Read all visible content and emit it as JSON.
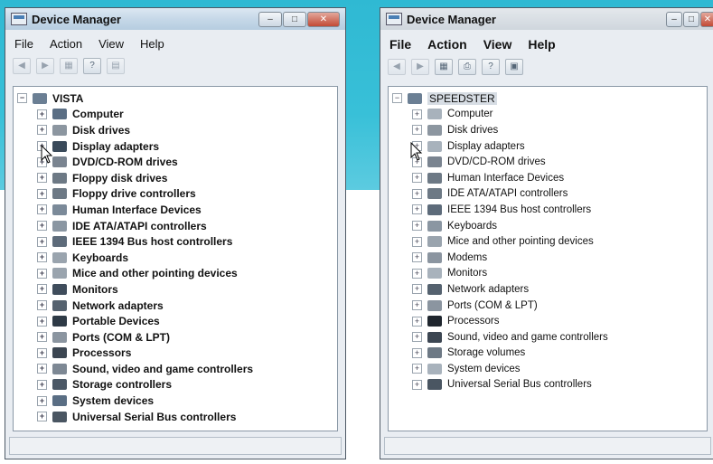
{
  "background_banner_color": "#38c0d8",
  "window_left": {
    "title": "Device Manager",
    "menu": [
      "File",
      "Action",
      "View",
      "Help"
    ],
    "root": "VISTA",
    "items": [
      {
        "label": "Computer",
        "icon": "computer-icon",
        "color": "#5a6e84"
      },
      {
        "label": "Disk drives",
        "icon": "disk-drive-icon",
        "color": "#8c96a0"
      },
      {
        "label": "Display adapters",
        "icon": "display-adapter-icon",
        "color": "#3a4a5a"
      },
      {
        "label": "DVD/CD-ROM drives",
        "icon": "dvd-drive-icon",
        "color": "#7a8490"
      },
      {
        "label": "Floppy disk drives",
        "icon": "floppy-drive-icon",
        "color": "#6d7985"
      },
      {
        "label": "Floppy drive controllers",
        "icon": "floppy-controller-icon",
        "color": "#6d7985"
      },
      {
        "label": "Human Interface Devices",
        "icon": "hid-icon",
        "color": "#7b8a99"
      },
      {
        "label": "IDE ATA/ATAPI controllers",
        "icon": "ide-controller-icon",
        "color": "#8a96a2"
      },
      {
        "label": "IEEE 1394 Bus host controllers",
        "icon": "ieee1394-icon",
        "color": "#5d6b7a"
      },
      {
        "label": "Keyboards",
        "icon": "keyboard-icon",
        "color": "#9aa4ae"
      },
      {
        "label": "Mice and other pointing devices",
        "icon": "mouse-icon",
        "color": "#9aa4ae"
      },
      {
        "label": "Monitors",
        "icon": "monitor-icon",
        "color": "#3f4d5c"
      },
      {
        "label": "Network adapters",
        "icon": "network-adapter-icon",
        "color": "#55626f"
      },
      {
        "label": "Portable Devices",
        "icon": "portable-device-icon",
        "color": "#2e3a46"
      },
      {
        "label": "Ports (COM & LPT)",
        "icon": "port-icon",
        "color": "#8b95a0"
      },
      {
        "label": "Processors",
        "icon": "processor-icon",
        "color": "#3c4652"
      },
      {
        "label": "Sound, video and game controllers",
        "icon": "sound-icon",
        "color": "#7d8894"
      },
      {
        "label": "Storage controllers",
        "icon": "storage-controller-icon",
        "color": "#4b5866"
      },
      {
        "label": "System devices",
        "icon": "system-device-icon",
        "color": "#5a6e84"
      },
      {
        "label": "Universal Serial Bus controllers",
        "icon": "usb-icon",
        "color": "#4a5662"
      }
    ]
  },
  "window_right": {
    "title": "Device Manager",
    "menu": [
      "File",
      "Action",
      "View",
      "Help"
    ],
    "root": "SPEEDSTER",
    "items": [
      {
        "label": "Computer",
        "icon": "computer-icon",
        "color": "#a8b2bc"
      },
      {
        "label": "Disk drives",
        "icon": "disk-drive-icon",
        "color": "#8c96a0"
      },
      {
        "label": "Display adapters",
        "icon": "display-adapter-icon",
        "color": "#a8b2bc"
      },
      {
        "label": "DVD/CD-ROM drives",
        "icon": "dvd-drive-icon",
        "color": "#7a8490"
      },
      {
        "label": "Human Interface Devices",
        "icon": "hid-icon",
        "color": "#6d7985"
      },
      {
        "label": "IDE ATA/ATAPI controllers",
        "icon": "ide-controller-icon",
        "color": "#6d7985"
      },
      {
        "label": "IEEE 1394 Bus host controllers",
        "icon": "ieee1394-icon",
        "color": "#5d6b7a"
      },
      {
        "label": "Keyboards",
        "icon": "keyboard-icon",
        "color": "#8a96a2"
      },
      {
        "label": "Mice and other pointing devices",
        "icon": "mouse-icon",
        "color": "#9aa4ae"
      },
      {
        "label": "Modems",
        "icon": "modem-icon",
        "color": "#8b95a0"
      },
      {
        "label": "Monitors",
        "icon": "monitor-icon",
        "color": "#a8b2bc"
      },
      {
        "label": "Network adapters",
        "icon": "network-adapter-icon",
        "color": "#55626f"
      },
      {
        "label": "Ports (COM & LPT)",
        "icon": "port-icon",
        "color": "#8b95a0"
      },
      {
        "label": "Processors",
        "icon": "processor-icon",
        "color": "#1f262e"
      },
      {
        "label": "Sound, video and game controllers",
        "icon": "sound-icon",
        "color": "#3c4652"
      },
      {
        "label": "Storage volumes",
        "icon": "storage-volume-icon",
        "color": "#6d7985"
      },
      {
        "label": "System devices",
        "icon": "system-device-icon",
        "color": "#a8b2bc"
      },
      {
        "label": "Universal Serial Bus controllers",
        "icon": "usb-icon",
        "color": "#4a5662"
      }
    ]
  }
}
